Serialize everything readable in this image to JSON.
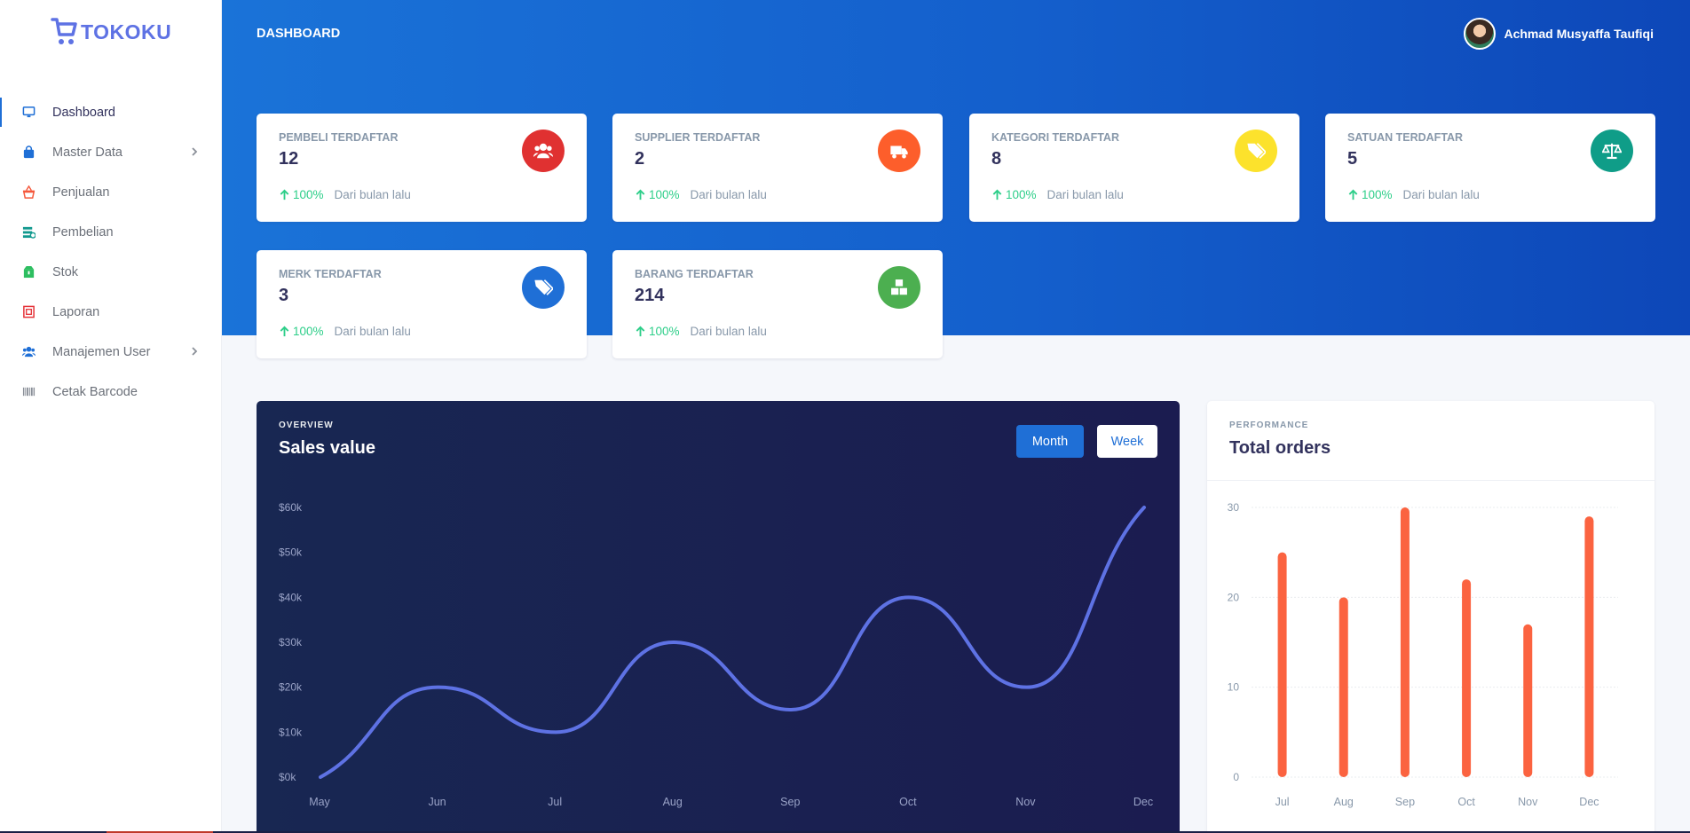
{
  "brand": {
    "name": "TOKOKU",
    "icon": "cart-icon",
    "color": "#5e72e4"
  },
  "header": {
    "title": "DASHBOARD",
    "user_name": "Achmad Musyaffa Taufiqi"
  },
  "sidebar": {
    "items": [
      {
        "label": "Dashboard",
        "icon": "monitor-icon",
        "color": "#1f6fd6",
        "active": true,
        "submenu": false
      },
      {
        "label": "Master Data",
        "icon": "bag-icon",
        "color": "#1f6fd6",
        "active": false,
        "submenu": true
      },
      {
        "label": "Penjualan",
        "icon": "basket-icon",
        "color": "#f5593d",
        "active": false,
        "submenu": false
      },
      {
        "label": "Pembelian",
        "icon": "database-icon",
        "color": "#11998e",
        "active": false,
        "submenu": false
      },
      {
        "label": "Stok",
        "icon": "box-icon",
        "color": "#2dbe60",
        "active": false,
        "submenu": false
      },
      {
        "label": "Laporan",
        "icon": "report-icon",
        "color": "#e5343a",
        "active": false,
        "submenu": false
      },
      {
        "label": "Manajemen User",
        "icon": "users-icon",
        "color": "#1f6fd6",
        "active": false,
        "submenu": true
      },
      {
        "label": "Cetak Barcode",
        "icon": "barcode-icon",
        "color": "#8a8f98",
        "active": false,
        "submenu": false
      }
    ]
  },
  "stats": [
    {
      "title": "PEMBELI TERDAFTAR",
      "value": "12",
      "pct": "100%",
      "sub": "Dari bulan lalu",
      "icon": "users-icon",
      "color": "#e03131"
    },
    {
      "title": "SUPPLIER TERDAFTAR",
      "value": "2",
      "pct": "100%",
      "sub": "Dari bulan lalu",
      "icon": "truck-icon",
      "color": "#fd5e2b"
    },
    {
      "title": "KATEGORI TERDAFTAR",
      "value": "8",
      "pct": "100%",
      "sub": "Dari bulan lalu",
      "icon": "tags-icon",
      "color": "#fce22c"
    },
    {
      "title": "SATUAN TERDAFTAR",
      "value": "5",
      "pct": "100%",
      "sub": "Dari bulan lalu",
      "icon": "balance-scale-icon",
      "color": "#0f9d88"
    },
    {
      "title": "MERK TERDAFTAR",
      "value": "3",
      "pct": "100%",
      "sub": "Dari bulan lalu",
      "icon": "tags-icon",
      "color": "#1f6fd6"
    },
    {
      "title": "BARANG TERDAFTAR",
      "value": "214",
      "pct": "100%",
      "sub": "Dari bulan lalu",
      "icon": "boxes-icon",
      "color": "#4caf50"
    }
  ],
  "sales": {
    "overline": "OVERVIEW",
    "title": "Sales value",
    "btn_month": "Month",
    "btn_week": "Week"
  },
  "orders": {
    "overline": "PERFORMANCE",
    "title": "Total orders"
  },
  "chart_data": [
    {
      "type": "line",
      "categories": [
        "May",
        "Jun",
        "Jul",
        "Aug",
        "Sep",
        "Oct",
        "Nov",
        "Dec"
      ],
      "values": [
        0,
        20,
        10,
        30,
        15,
        40,
        20,
        60
      ],
      "ytick_labels": [
        "$0k",
        "$10k",
        "$20k",
        "$30k",
        "$40k",
        "$50k",
        "$60k"
      ],
      "ylim": [
        0,
        60
      ],
      "line_color": "#5e72e4",
      "grid": false
    },
    {
      "type": "bar",
      "categories": [
        "Jul",
        "Aug",
        "Sep",
        "Oct",
        "Nov",
        "Dec"
      ],
      "values": [
        25,
        20,
        30,
        22,
        17,
        29
      ],
      "ytick_labels": [
        "0",
        "10",
        "20",
        "30"
      ],
      "ylim": [
        0,
        30
      ],
      "bar_color": "#fb6340",
      "grid": true
    }
  ]
}
